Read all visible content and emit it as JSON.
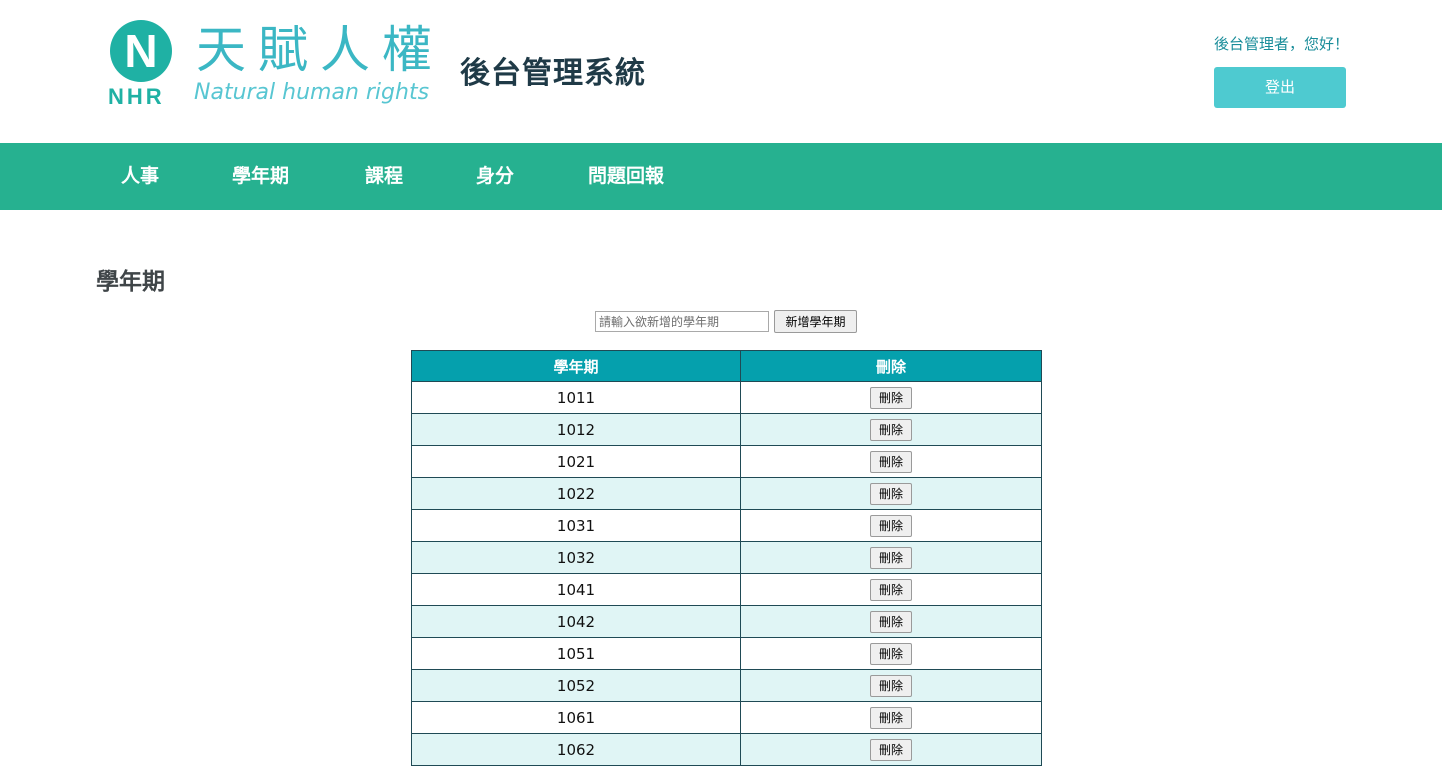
{
  "header": {
    "logo": {
      "letter": "N",
      "abbr": "NHR",
      "name_cn": "天賦人權",
      "name_en": "Natural human rights"
    },
    "system_title": "後台管理系統",
    "greeting": "後台管理者，您好！",
    "logout_label": "登出"
  },
  "nav": {
    "items": [
      "人事",
      "學年期",
      "課程",
      "身分",
      "問題回報"
    ]
  },
  "main": {
    "title": "學年期",
    "input_placeholder": "請輸入欲新增的學年期",
    "add_button_label": "新增學年期",
    "table": {
      "headers": [
        "學年期",
        "刪除"
      ],
      "delete_label": "刪除",
      "rows": [
        "1011",
        "1012",
        "1021",
        "1022",
        "1031",
        "1032",
        "1041",
        "1042",
        "1051",
        "1052",
        "1061",
        "1062"
      ]
    }
  },
  "colors": {
    "nav_bg": "#26b190",
    "table_header_bg": "#05a0ad",
    "row_alt_bg": "#e0f5f5",
    "logout_bg": "#4ecad0",
    "logo_teal": "#1fb1a4"
  }
}
